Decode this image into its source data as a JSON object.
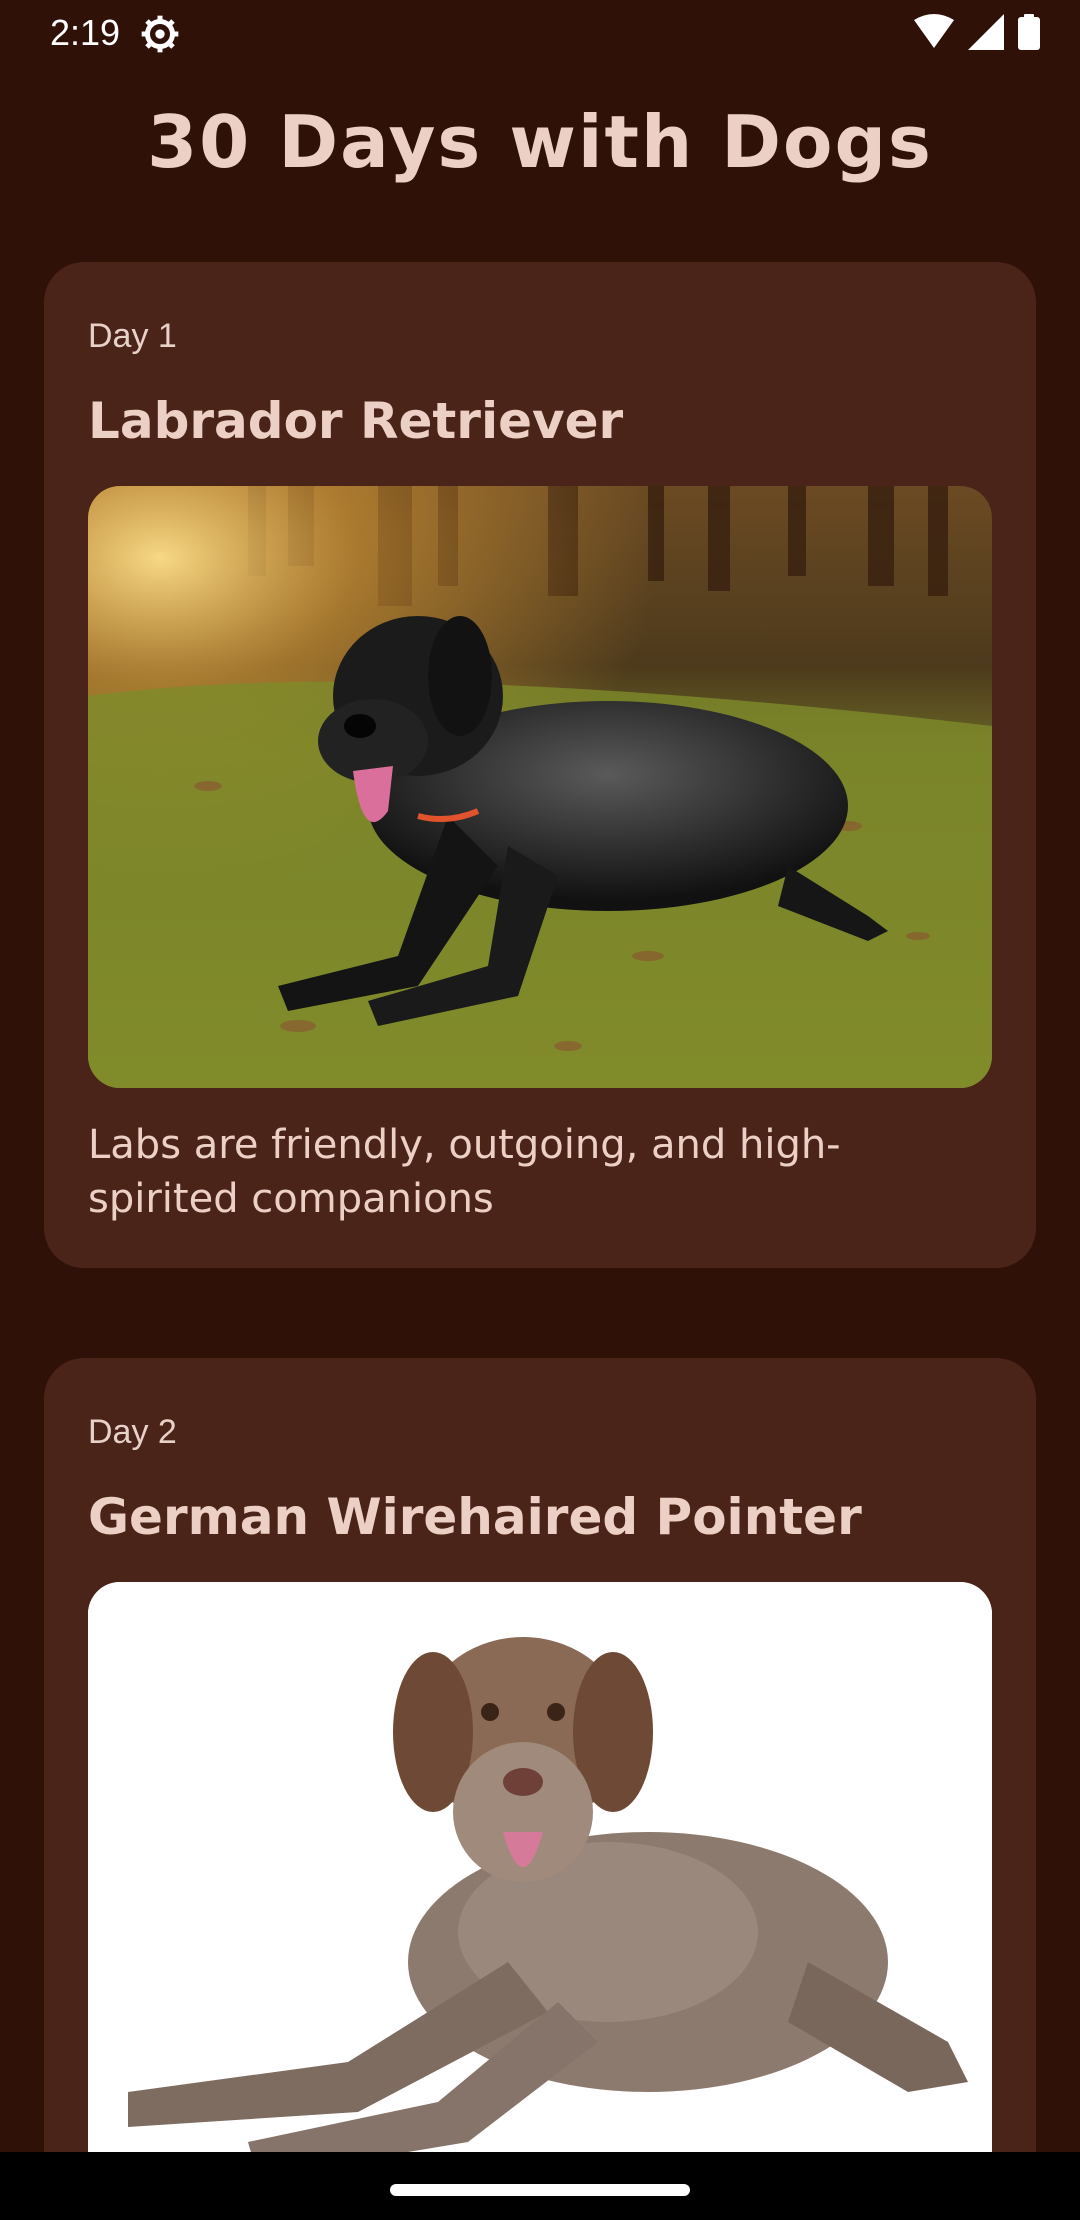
{
  "status": {
    "time": "2:19",
    "icons": [
      "settings-icon",
      "wifi-icon",
      "cellular-signal-icon",
      "battery-icon"
    ]
  },
  "app": {
    "title": "30 Days with Dogs"
  },
  "cards": [
    {
      "day": "Day 1",
      "name": "Labrador Retriever",
      "description": "Labs are friendly, outgoing, and high-spirited companions",
      "image": "labrador-retriever-photo"
    },
    {
      "day": "Day 2",
      "name": "German Wirehaired Pointer",
      "image": "german-wirehaired-pointer-photo"
    }
  ],
  "colors": {
    "background": "#2f1108",
    "card": "#4a2319",
    "title_text": "#ecd0c5"
  }
}
